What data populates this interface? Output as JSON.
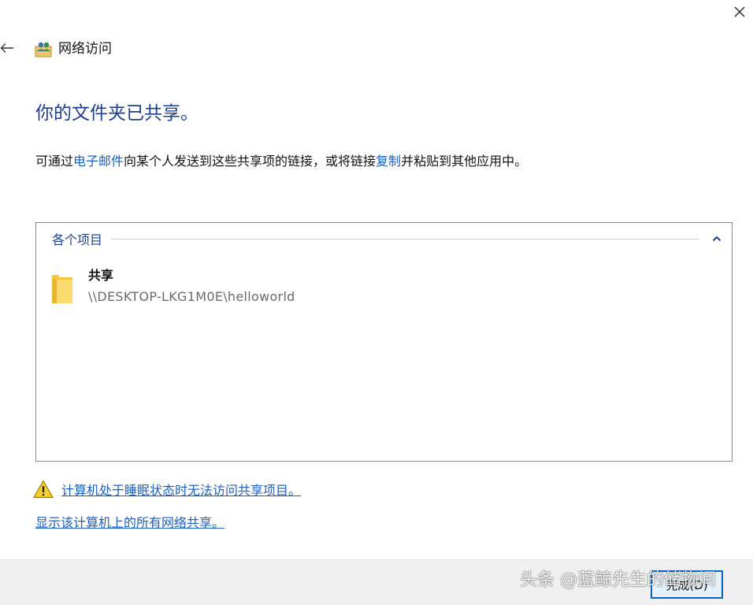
{
  "window": {
    "title": "网络访问"
  },
  "heading": "你的文件夹已共享。",
  "description": {
    "part1": "可通过",
    "email_link": "电子邮件",
    "part2": "向某个人发送到这些共享项的链接，或将链接",
    "copy_link": "复制",
    "part3": "并粘贴到其他应用中。"
  },
  "items_group": {
    "label": "各个项目",
    "items": [
      {
        "name": "共享",
        "path": "\\\\DESKTOP-LKG1M0E\\helloworld"
      }
    ]
  },
  "links": {
    "sleep_warning": "计算机处于睡眠状态时无法访问共享项目。",
    "show_all": "显示该计算机上的所有网络共享。"
  },
  "footer": {
    "finish_label": "完成(D)"
  },
  "watermark": "头条 @蓝鲸先生的储物间",
  "colors": {
    "heading": "#1c3f95",
    "link": "#1a5fc8",
    "footer_bg": "#f0f0f0",
    "button_border": "#0a64c8"
  }
}
